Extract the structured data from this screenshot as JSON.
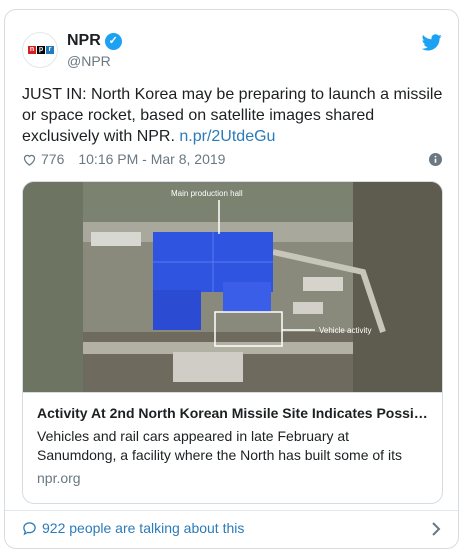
{
  "account": {
    "name": "NPR",
    "handle": "@NPR",
    "logo_letters": [
      "n",
      "p",
      "r"
    ]
  },
  "tweet": {
    "text_before_link": "JUST IN: North Korea may be preparing to launch a missile or space rocket, based on satellite images shared exclusively with NPR. ",
    "link": "n.pr/2UtdeGu",
    "likes": "776",
    "timestamp": "10:16 PM - Mar 8, 2019"
  },
  "card": {
    "image_labels": {
      "main_production_hall": "Main production hall",
      "vehicle_activity": "Vehicle activity"
    },
    "title": "Activity At 2nd North Korean Missile Site Indicates Possi…",
    "description": "Vehicles and rail cars appeared in late February at Sanumdong, a facility where the North has built some of its",
    "domain": "npr.org"
  },
  "footer": {
    "talking": "922 people are talking about this"
  },
  "colors": {
    "link": "#2b7bb9",
    "twitter_blue": "#1da1f2",
    "muted": "#697882"
  }
}
